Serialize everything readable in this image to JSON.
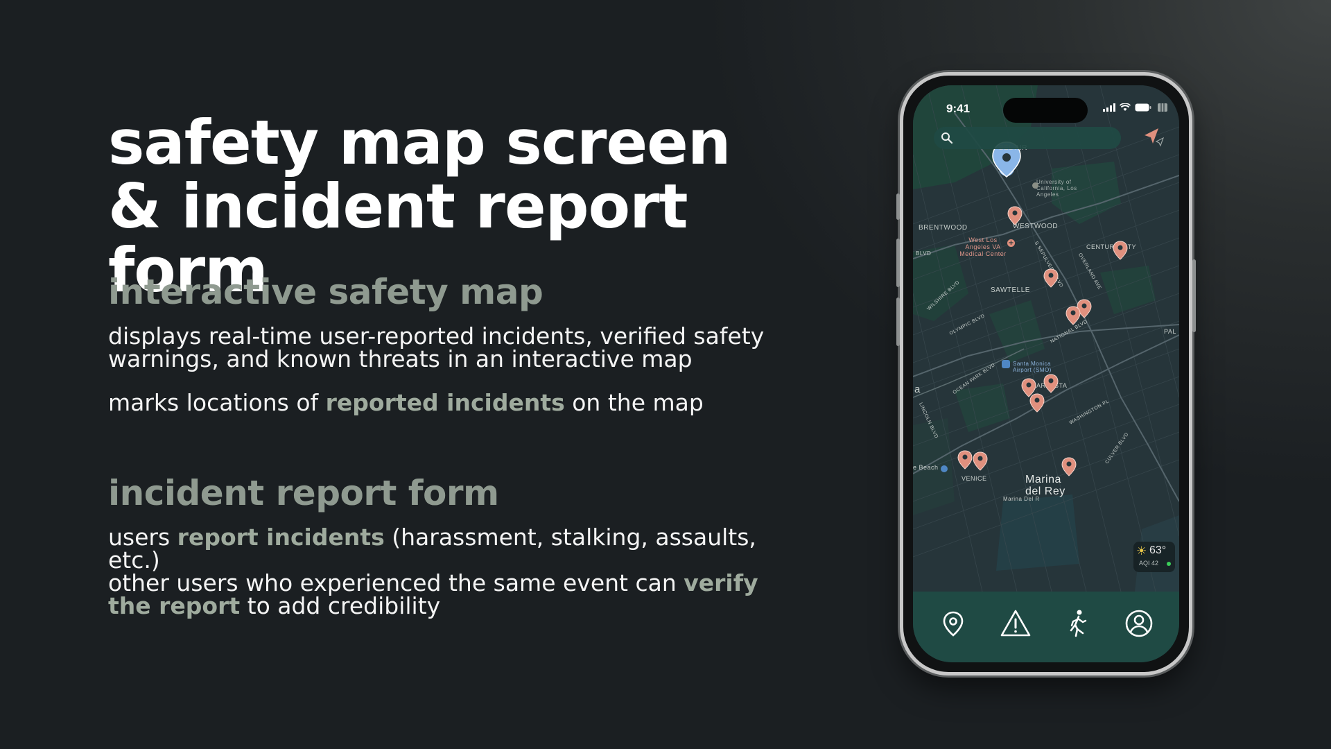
{
  "heading": {
    "line1": "safety map screen",
    "line2": "& incident report form"
  },
  "map_section": {
    "title": "interactive safety map",
    "description": "displays real-time user-reported incidents, verified safety warnings, and known threats in an interactive map",
    "marks_prefix": "marks locations of ",
    "marks_highlight": "reported incidents",
    "marks_suffix": " on the map"
  },
  "form_section": {
    "title": "incident report form",
    "report_prefix": "users ",
    "report_highlight": "report incidents",
    "report_suffix": " (harassment, stalking, assaults, etc.)",
    "verify_prefix": "other users who experienced the same event can ",
    "verify_highlight": "verify the report",
    "verify_suffix": " to add credibility"
  },
  "phone": {
    "status_time": "9:41",
    "map_labels": {
      "bel_air": "BEL AIR",
      "ucla": "University of California, Los Angeles",
      "brentwood": "BRENTWOOD",
      "westwood": "WESTWOOD",
      "va_center": "West Los Angeles VA Medical Center",
      "century_city": "CENTURY CITY",
      "sawtelle": "SAWTELLE",
      "blvd": "BLVD",
      "wilshire": "WILSHIRE BLVD",
      "sepulveda": "S SEPULVEDA BLVD",
      "overland": "OVERLAND AVE",
      "olympic": "OLYMPIC BLVD",
      "national": "NATIONAL BLVD",
      "pal": "PAL",
      "ocean_park": "OCEAN PARK BLVD",
      "smo": "Santa Monica Airport (SMO)",
      "mar_vista": "MAR VISTA",
      "a": "a",
      "washington": "WASHINGTON PL",
      "lincoln": "LINCOLN BLVD",
      "culver": "CULVER BLVD",
      "beach": "e Beach",
      "venice": "VENICE",
      "marina": "Marina del Rey",
      "marina_del": "Marina Del R"
    },
    "weather_temp": "63°",
    "weather_aqi": "AQI 42",
    "nav_items": [
      "map-pin",
      "warning",
      "walking",
      "profile"
    ],
    "colors": {
      "nav_bg": "#1f4a44",
      "incident_pin": "#e0907e",
      "user_pin": "#8ab6e8"
    }
  }
}
